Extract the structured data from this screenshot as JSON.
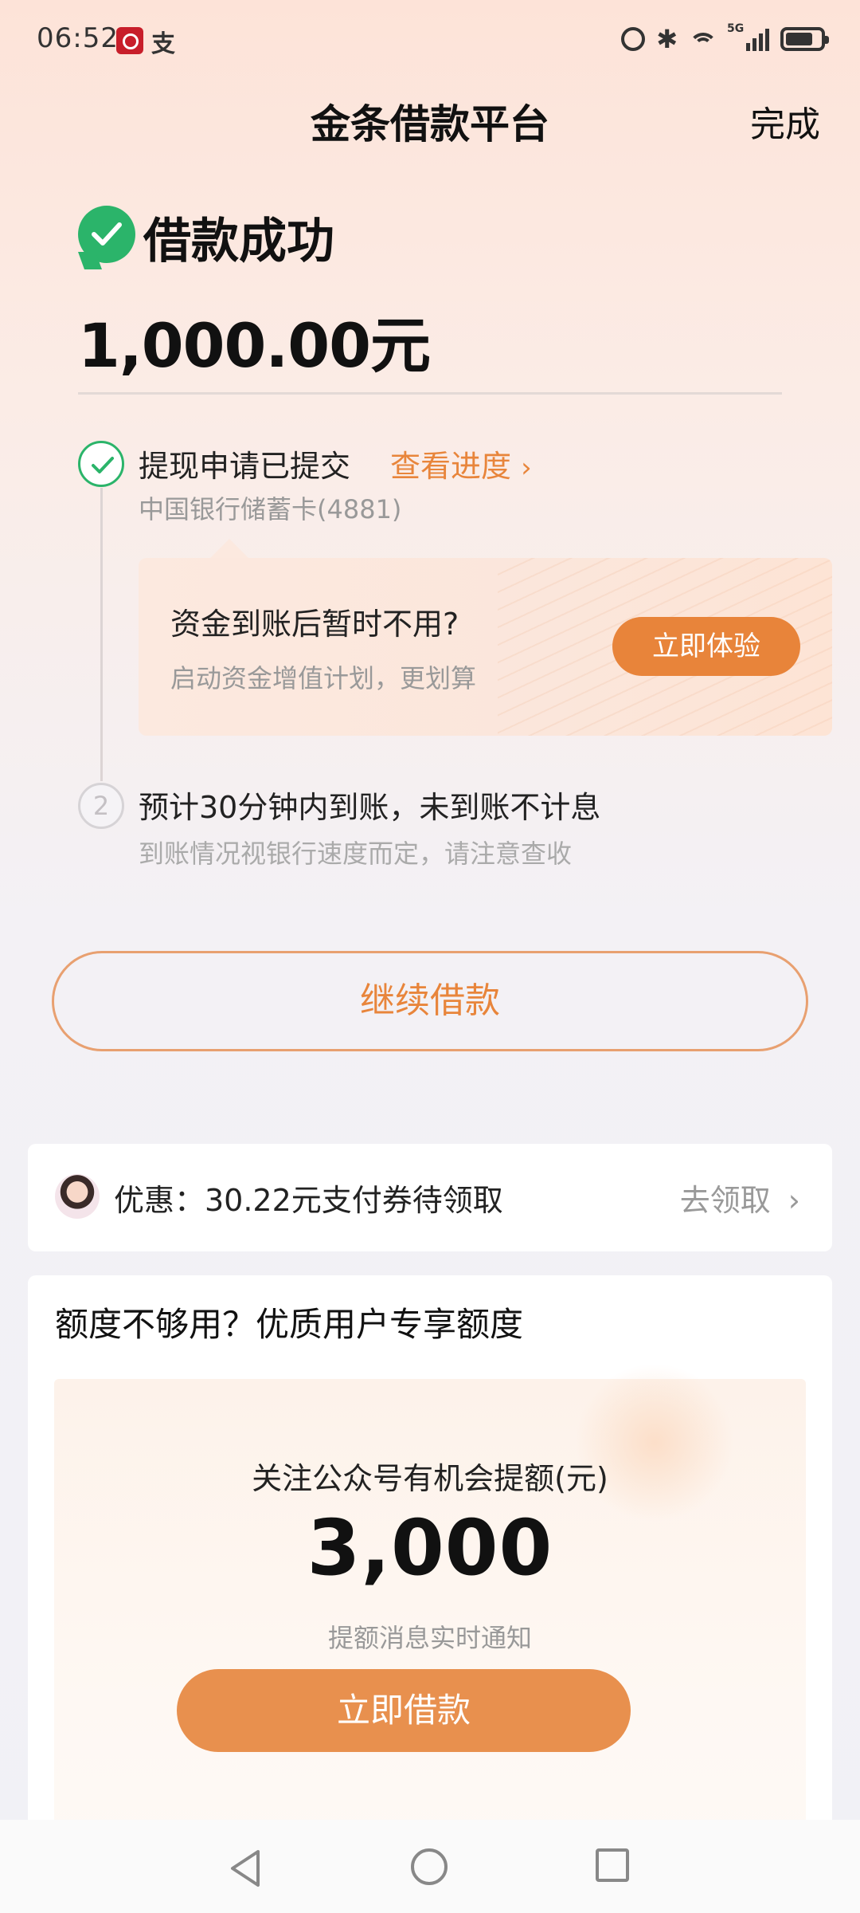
{
  "status_bar": {
    "time": "06:52",
    "app_icon_2": "支",
    "signal_label": "5G",
    "icons": [
      "bank-app-icon",
      "alipay-icon",
      "alarm-icon",
      "bluetooth-icon",
      "wifi-icon",
      "signal-icon",
      "battery-icon"
    ]
  },
  "header": {
    "title": "金条借款平台",
    "done_label": "完成"
  },
  "result": {
    "title": "借款成功",
    "amount": "1,000.00元"
  },
  "steps": [
    {
      "title": "提现申请已提交",
      "link_label": "查看进度",
      "subtitle": "中国银行储蓄卡(4881)"
    },
    {
      "number": "2",
      "title": "预计30分钟内到账，未到账不计息",
      "subtitle": "到账情况视银行速度而定，请注意查收"
    }
  ],
  "promo": {
    "title": "资金到账后暂时不用?",
    "subtitle": "启动资金增值计划，更划算",
    "button_label": "立即体验"
  },
  "continue_button_label": "继续借款",
  "coupon": {
    "text": "优惠：30.22元支付券待领取",
    "action_label": "去领取"
  },
  "quota": {
    "title": "额度不够用？优质用户专享额度",
    "label": "关注公众号有机会提额(元)",
    "value": "3,000",
    "note": "提额消息实时通知",
    "button_label": "立即借款"
  },
  "colors": {
    "accent": "#e8853b",
    "success": "#2bb46a"
  }
}
